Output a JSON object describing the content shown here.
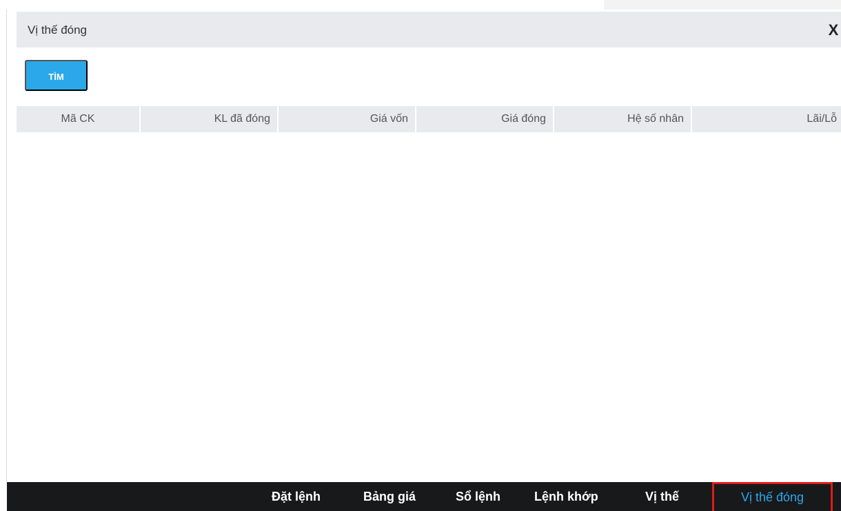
{
  "dialog": {
    "title": "Vị thế đóng",
    "close_label": "X",
    "search_button_label": "TÌM"
  },
  "table": {
    "columns": [
      "Mã CK",
      "KL đã đóng",
      "Giá vốn",
      "Giá đóng",
      "Hệ số nhân",
      "Lãi/Lỗ"
    ],
    "rows": []
  },
  "bottom_nav": {
    "items": [
      "Đặt lệnh",
      "Bảng giá",
      "Sổ lệnh",
      "Lệnh khớp",
      "Vị thế",
      "Vị thế đóng"
    ],
    "active_item": "Vị thế đóng"
  },
  "colors": {
    "accent": "#2ba8e9",
    "header_background": "#e9eaee",
    "nav_background": "#18191b",
    "active_border": "#e01a1a"
  }
}
